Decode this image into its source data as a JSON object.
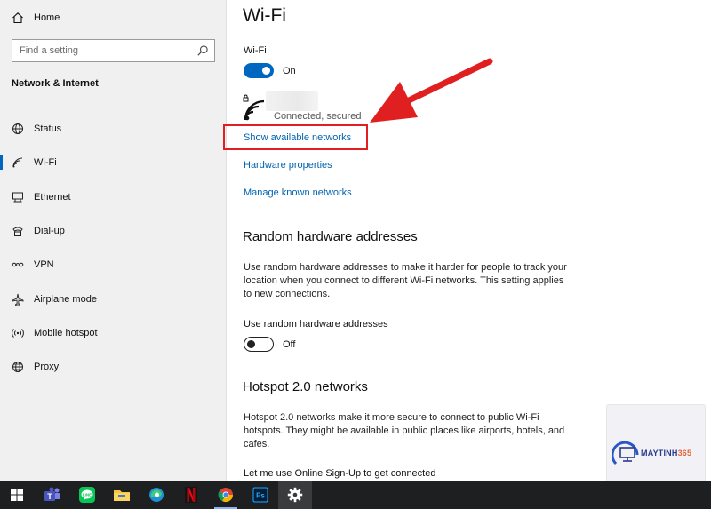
{
  "sidebar": {
    "home_label": "Home",
    "search_placeholder": "Find a setting",
    "section_title": "Network & Internet",
    "items": [
      {
        "label": "Status",
        "icon": "globe-status-icon"
      },
      {
        "label": "Wi-Fi",
        "icon": "wifi-icon",
        "active": true
      },
      {
        "label": "Ethernet",
        "icon": "ethernet-icon"
      },
      {
        "label": "Dial-up",
        "icon": "dialup-icon"
      },
      {
        "label": "VPN",
        "icon": "vpn-icon"
      },
      {
        "label": "Airplane mode",
        "icon": "airplane-icon"
      },
      {
        "label": "Mobile hotspot",
        "icon": "hotspot-icon"
      },
      {
        "label": "Proxy",
        "icon": "globe-icon"
      }
    ]
  },
  "main": {
    "title": "Wi-Fi",
    "wifi_label": "Wi-Fi",
    "wifi_state": "On",
    "network_status": "Connected, secured",
    "links": {
      "show_networks": "Show available networks",
      "hardware_properties": "Hardware properties",
      "manage_known": "Manage known networks"
    },
    "random_hw": {
      "heading": "Random hardware addresses",
      "description": "Use random hardware addresses to make it harder for people to track your location when you connect to different Wi-Fi networks. This setting applies to new connections.",
      "toggle_label": "Use random hardware addresses",
      "toggle_state": "Off"
    },
    "hotspot": {
      "heading": "Hotspot 2.0 networks",
      "description": "Hotspot 2.0 networks make it more secure to connect to public Wi-Fi hotspots. They might be available in public places like airports, hotels, and cafes.",
      "signup_label": "Let me use Online Sign-Up to get connected"
    }
  },
  "watermark": {
    "brand_main": "MAYTINH",
    "brand_accent": "365"
  },
  "colors": {
    "accent": "#0067c0",
    "link": "#0063b1",
    "annotation_red": "#e02020",
    "taskbar": "#1e1f21"
  },
  "taskbar": {
    "items": [
      "windows-start-icon",
      "teams-icon",
      "line-icon",
      "file-explorer-icon",
      "edge-icon",
      "netflix-icon",
      "chrome-icon",
      "photoshop-icon",
      "settings-icon"
    ]
  }
}
